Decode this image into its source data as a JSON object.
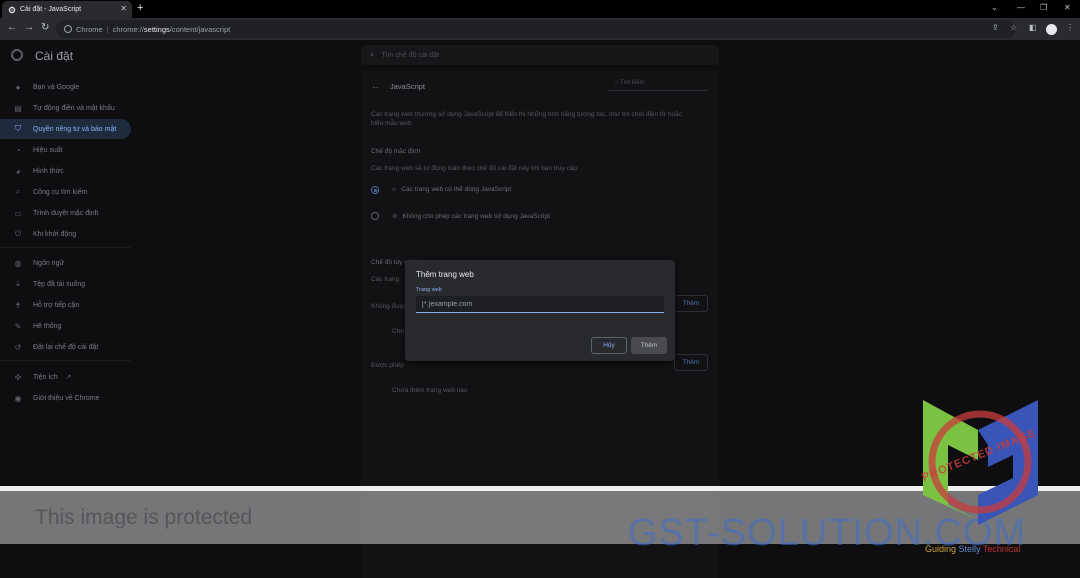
{
  "browser": {
    "tab_title": "Cài đặt - JavaScript",
    "new_tab_label": "+",
    "address_origin": "Chrome",
    "address_scheme": "chrome://",
    "address_path_bold": "settings",
    "address_path_rest": "/content/javascript"
  },
  "header": {
    "title": "Cài đặt",
    "search_placeholder": "Tìm chế độ cài đặt"
  },
  "sidebar": {
    "items": [
      {
        "label": "Bạn và Google",
        "icon": "person-icon"
      },
      {
        "label": "Tự động điền và mật khẩu",
        "icon": "autofill-icon"
      },
      {
        "label": "Quyền riêng tư và bảo mật",
        "icon": "shield-icon",
        "active": true
      },
      {
        "label": "Hiệu suất",
        "icon": "speed-icon"
      },
      {
        "label": "Hình thức",
        "icon": "palette-icon"
      },
      {
        "label": "Công cụ tìm kiếm",
        "icon": "search-icon"
      },
      {
        "label": "Trình duyệt mặc định",
        "icon": "browser-icon"
      },
      {
        "label": "Khi khởi động",
        "icon": "power-icon"
      },
      {
        "label": "Ngôn ngữ",
        "icon": "globe-icon"
      },
      {
        "label": "Tệp đã tải xuống",
        "icon": "download-icon"
      },
      {
        "label": "Hỗ trợ tiếp cận",
        "icon": "accessibility-icon"
      },
      {
        "label": "Hệ thống",
        "icon": "wrench-icon"
      },
      {
        "label": "Đặt lại chế độ cài đặt",
        "icon": "reset-icon"
      },
      {
        "label": "Tiện ích",
        "icon": "puzzle-icon"
      },
      {
        "label": "Giới thiệu về Chrome",
        "icon": "chrome-icon"
      }
    ]
  },
  "content": {
    "title": "JavaScript",
    "search_placeholder": "Tìm kiếm",
    "intro_line1": "Các trang web thường sử dụng JavaScript để hiển thị những tính năng tương tác, như trò chơi điện tử hoặc",
    "intro_line2": "biểu mẫu web",
    "default_heading": "Chế độ mặc định",
    "default_desc": "Các trang web sẽ tự động tuân theo chế độ cài đặt này khi bạn truy cập",
    "option_allow": "Các trang web có thể dùng JavaScript",
    "option_block": "Không cho phép các trang web sử dụng JavaScript",
    "custom_heading": "Chế độ tùy chỉnh",
    "custom_desc": "Các trang",
    "not_allowed_label": "Không được",
    "not_allowed_empty": "Chưa",
    "allowed_label": "Được phép",
    "allowed_empty": "Chưa thêm trang web nào",
    "add_button": "Thêm"
  },
  "dialog": {
    "title": "Thêm trang web",
    "field_label": "Trang web",
    "field_placeholder": "[*.]example.com",
    "cancel_label": "Hủy",
    "add_label": "Thêm"
  },
  "watermark": {
    "protected_text": "This image is protected",
    "brand": "GST-SOLUTION.COM",
    "tagline_a": "Guiding",
    "tagline_b": "Stelly",
    "tagline_c": "Technical",
    "stamp": "PROTECTED IMAGE"
  }
}
